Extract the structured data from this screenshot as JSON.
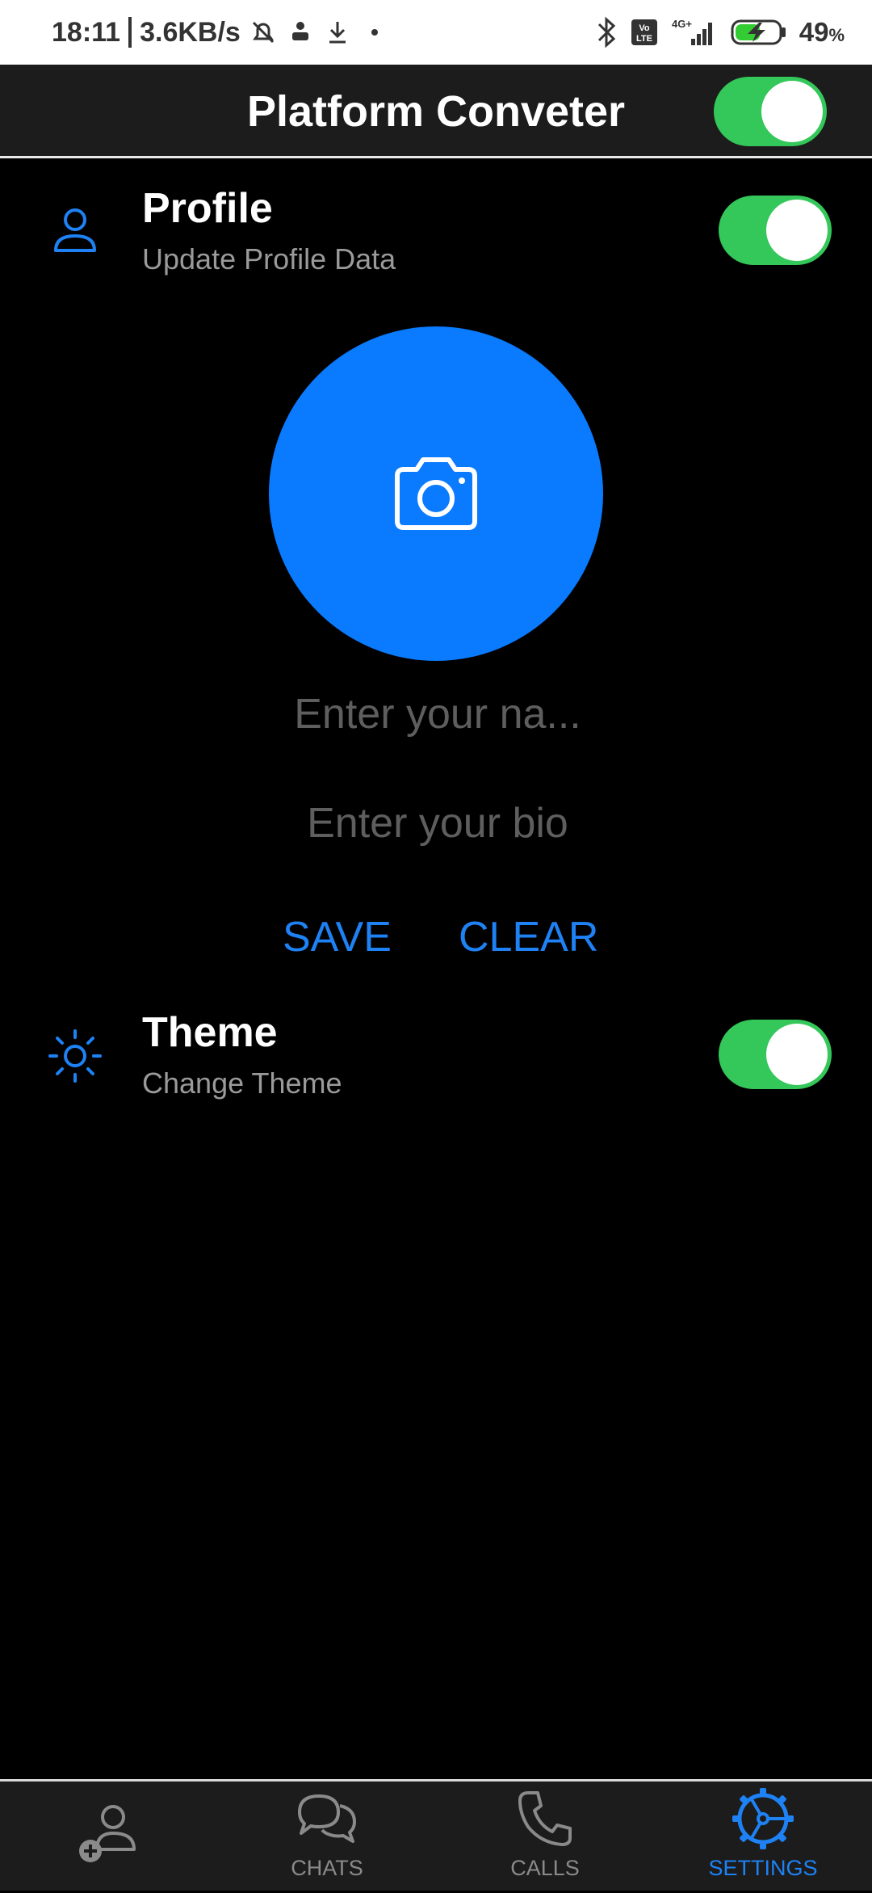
{
  "status_bar": {
    "time": "18:11",
    "network_speed": "3.6KB/s",
    "battery": "49",
    "battery_unit": "%",
    "signal_label": "4G+",
    "volte_label": "Vo LTE"
  },
  "app_bar": {
    "title": "Platform Conveter",
    "toggle_on": true
  },
  "profile_section": {
    "title": "Profile",
    "subtitle": "Update Profile Data",
    "toggle_on": true,
    "name_placeholder": "Enter your na...",
    "bio_placeholder": "Enter your bio",
    "save_label": "SAVE",
    "clear_label": "CLEAR"
  },
  "theme_section": {
    "title": "Theme",
    "subtitle": "Change Theme",
    "toggle_on": true
  },
  "bottom_nav": {
    "items": [
      {
        "label": "",
        "icon": "add-contact-icon",
        "active": false
      },
      {
        "label": "CHATS",
        "icon": "chat-icon",
        "active": false
      },
      {
        "label": "CALLS",
        "icon": "phone-icon",
        "active": false
      },
      {
        "label": "SETTINGS",
        "icon": "settings-icon",
        "active": true
      }
    ]
  },
  "colors": {
    "accent": "#1e82f5",
    "toggle_on": "#34c759",
    "avatar_bg": "#0a7aff",
    "background": "#000000",
    "bar_bg": "#1c1c1c"
  }
}
